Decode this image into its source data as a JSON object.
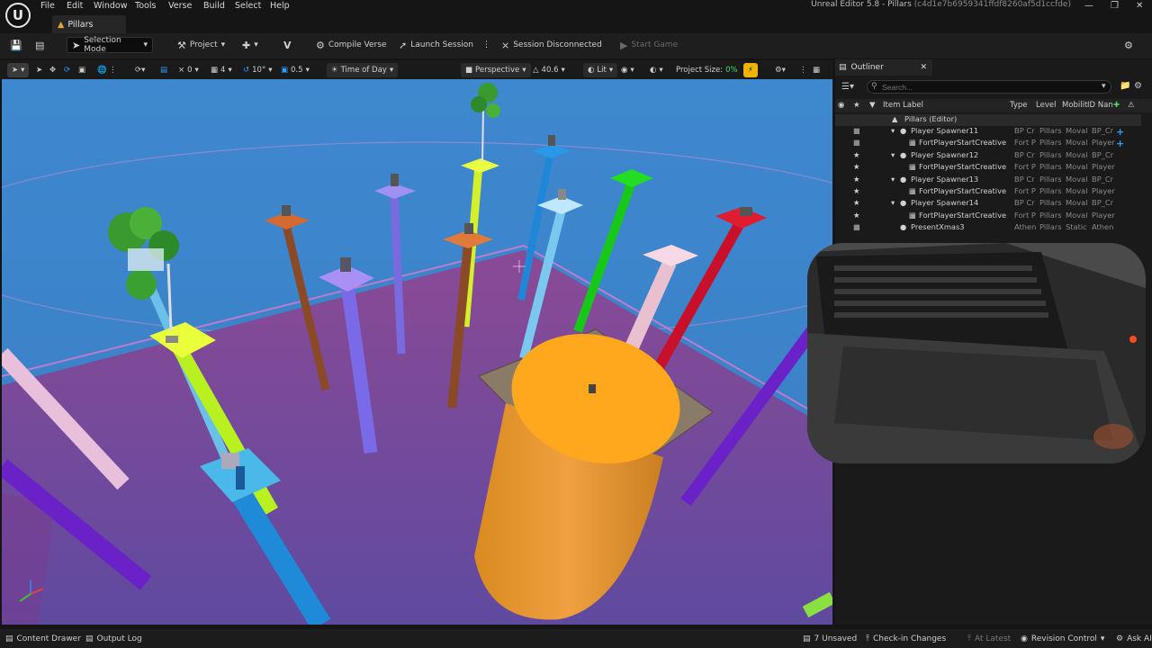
{
  "app": {
    "menu": [
      "File",
      "Edit",
      "Window",
      "Tools",
      "Verse",
      "Build",
      "Select",
      "Help"
    ],
    "title": "Unreal Editor 5.8 - Pillars",
    "title_hash": "(c4d1e7b6959341ffdf8260af5d1ccfde)",
    "tab_label": "Pillars",
    "logo_letter": "U"
  },
  "toolbar": {
    "selection_mode": "Selection Mode",
    "project": "Project",
    "compile_verse": "Compile Verse",
    "launch_session": "Launch Session",
    "session_status": "Session Disconnected",
    "start_game": "Start Game"
  },
  "viewport_toolbar": {
    "rotate_snap": "0",
    "grid_count": "4",
    "angle_snap": "10°",
    "scale_snap": "0.5",
    "time_of_day": "Time of Day",
    "perspective": "Perspective",
    "fov": "40.6",
    "lit": "Lit",
    "project_size_label": "Project Size:",
    "project_size_value": "0%"
  },
  "outliner": {
    "tab_label": "Outliner",
    "search_placeholder": "Search...",
    "columns": {
      "label": "Item Label",
      "type": "Type",
      "level": "Level",
      "mobility": "Mobilit",
      "id": "ID Nan"
    },
    "root": "Pillars (Editor)",
    "rows": [
      {
        "label": "Player Spawner11",
        "type": "BP Cr",
        "level": "Pillars",
        "mobility": "Moval",
        "id": "BP_Cr",
        "star": false
      },
      {
        "label": "FortPlayerStartCreative",
        "type": "Fort P",
        "level": "Pillars",
        "mobility": "Moval",
        "id": "Player",
        "star": false
      },
      {
        "label": "Player Spawner12",
        "type": "BP Cr",
        "level": "Pillars",
        "mobility": "Moval",
        "id": "BP_Cr",
        "star": true
      },
      {
        "label": "FortPlayerStartCreative",
        "type": "Fort P",
        "level": "Pillars",
        "mobility": "Moval",
        "id": "Player",
        "star": true
      },
      {
        "label": "Player Spawner13",
        "type": "BP Cr",
        "level": "Pillars",
        "mobility": "Moval",
        "id": "BP_Cr",
        "star": true
      },
      {
        "label": "FortPlayerStartCreative",
        "type": "Fort P",
        "level": "Pillars",
        "mobility": "Moval",
        "id": "Player",
        "star": true
      },
      {
        "label": "Player Spawner14",
        "type": "BP Cr",
        "level": "Pillars",
        "mobility": "Moval",
        "id": "BP_Cr",
        "star": true
      },
      {
        "label": "FortPlayerStartCreative",
        "type": "Fort P",
        "level": "Pillars",
        "mobility": "Moval",
        "id": "Player",
        "star": true
      },
      {
        "label": "PresentXmas3",
        "type": "Athen",
        "level": "Pillars",
        "mobility": "Static",
        "id": "Athen",
        "star": false
      }
    ]
  },
  "statusbar": {
    "content_drawer": "Content Drawer",
    "output_log": "Output Log",
    "unsaved": "7 Unsaved",
    "checkin": "Check-in Changes",
    "at_latest": "At Latest",
    "revision_control": "Revision Control",
    "ask_ai": "Ask AI"
  },
  "colors": {
    "accent_blue": "#2ea0ff",
    "project_size_green": "#4cd964",
    "floor_purple": "#7a4a9e",
    "sky_blue": "#3c83c8"
  }
}
